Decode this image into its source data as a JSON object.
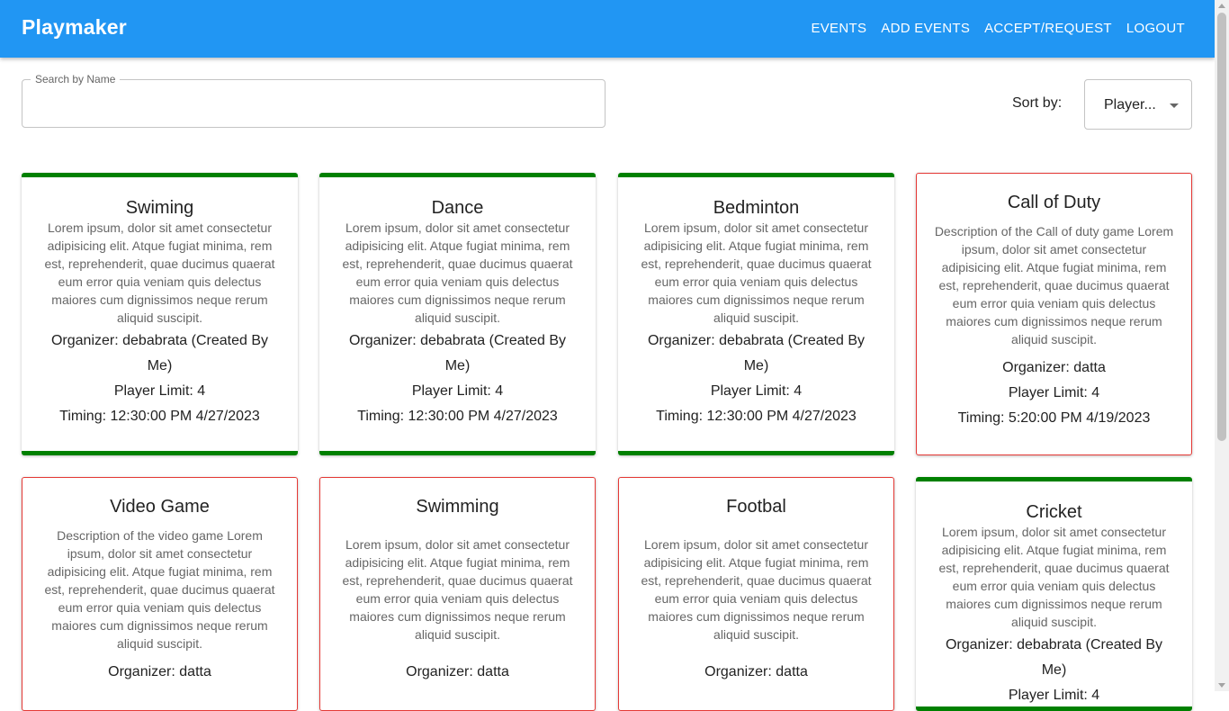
{
  "app": {
    "brand": "Playmaker",
    "nav": [
      "EVENTS",
      "ADD EVENTS",
      "ACCEPT/REQUEST",
      "LOGOUT"
    ],
    "colors": {
      "appbar": "#2196f3",
      "mine_border": "#008000",
      "other_border": "#e53935"
    }
  },
  "search": {
    "label": "Search by Name",
    "value": ""
  },
  "sort": {
    "label": "Sort by:",
    "value": "Player..."
  },
  "cards": [
    {
      "title": "Swiming",
      "description": "Lorem ipsum, dolor sit amet consectetur adipisicing elit. Atque fugiat minima, rem est, reprehenderit, quae ducimus quaerat eum error quia veniam quis delectus maiores cum dignissimos neque rerum aliquid suscipit.",
      "organizer": "Organizer: debabrata (Created By Me)",
      "player_limit": "Player Limit: 4",
      "timing": "Timing: 12:30:00 PM 4/27/2023",
      "owned": true
    },
    {
      "title": "Dance",
      "description": "Lorem ipsum, dolor sit amet consectetur adipisicing elit. Atque fugiat minima, rem est, reprehenderit, quae ducimus quaerat eum error quia veniam quis delectus maiores cum dignissimos neque rerum aliquid suscipit.",
      "organizer": "Organizer: debabrata (Created By Me)",
      "player_limit": "Player Limit: 4",
      "timing": "Timing: 12:30:00 PM 4/27/2023",
      "owned": true
    },
    {
      "title": "Bedminton",
      "description": "Lorem ipsum, dolor sit amet consectetur adipisicing elit. Atque fugiat minima, rem est, reprehenderit, quae ducimus quaerat eum error quia veniam quis delectus maiores cum dignissimos neque rerum aliquid suscipit.",
      "organizer": "Organizer: debabrata (Created By Me)",
      "player_limit": "Player Limit: 4",
      "timing": "Timing: 12:30:00 PM 4/27/2023",
      "owned": true
    },
    {
      "title": "Call of Duty",
      "description": "Description of the Call of duty game Lorem ipsum, dolor sit amet consectetur adipisicing elit. Atque fugiat minima, rem est, reprehenderit, quae ducimus quaerat eum error quia veniam quis delectus maiores cum dignissimos neque rerum aliquid suscipit.",
      "organizer": "Organizer: datta",
      "player_limit": "Player Limit: 4",
      "timing": "Timing: 5:20:00 PM 4/19/2023",
      "owned": false
    },
    {
      "title": "Video Game",
      "description": "Description of the video game Lorem ipsum, dolor sit amet consectetur adipisicing elit. Atque fugiat minima, rem est, reprehenderit, quae ducimus quaerat eum error quia veniam quis delectus maiores cum dignissimos neque rerum aliquid suscipit.",
      "organizer": "Organizer: datta",
      "player_limit": "",
      "timing": "",
      "owned": false
    },
    {
      "title": "Swimming",
      "description": "Lorem ipsum, dolor sit amet consectetur adipisicing elit. Atque fugiat minima, rem est, reprehenderit, quae ducimus quaerat eum error quia veniam quis delectus maiores cum dignissimos neque rerum aliquid suscipit.",
      "organizer": "Organizer: datta",
      "player_limit": "",
      "timing": "",
      "owned": false
    },
    {
      "title": "Footbal",
      "description": "Lorem ipsum, dolor sit amet consectetur adipisicing elit. Atque fugiat minima, rem est, reprehenderit, quae ducimus quaerat eum error quia veniam quis delectus maiores cum dignissimos neque rerum aliquid suscipit.",
      "organizer": "Organizer: datta",
      "player_limit": "",
      "timing": "",
      "owned": false
    },
    {
      "title": "Cricket",
      "description": "Lorem ipsum, dolor sit amet consectetur adipisicing elit. Atque fugiat minima, rem est, reprehenderit, quae ducimus quaerat eum error quia veniam quis delectus maiores cum dignissimos neque rerum aliquid suscipit.",
      "organizer": "Organizer: debabrata (Created By Me)",
      "player_limit": "Player Limit: 4",
      "timing": "",
      "owned": true
    }
  ]
}
